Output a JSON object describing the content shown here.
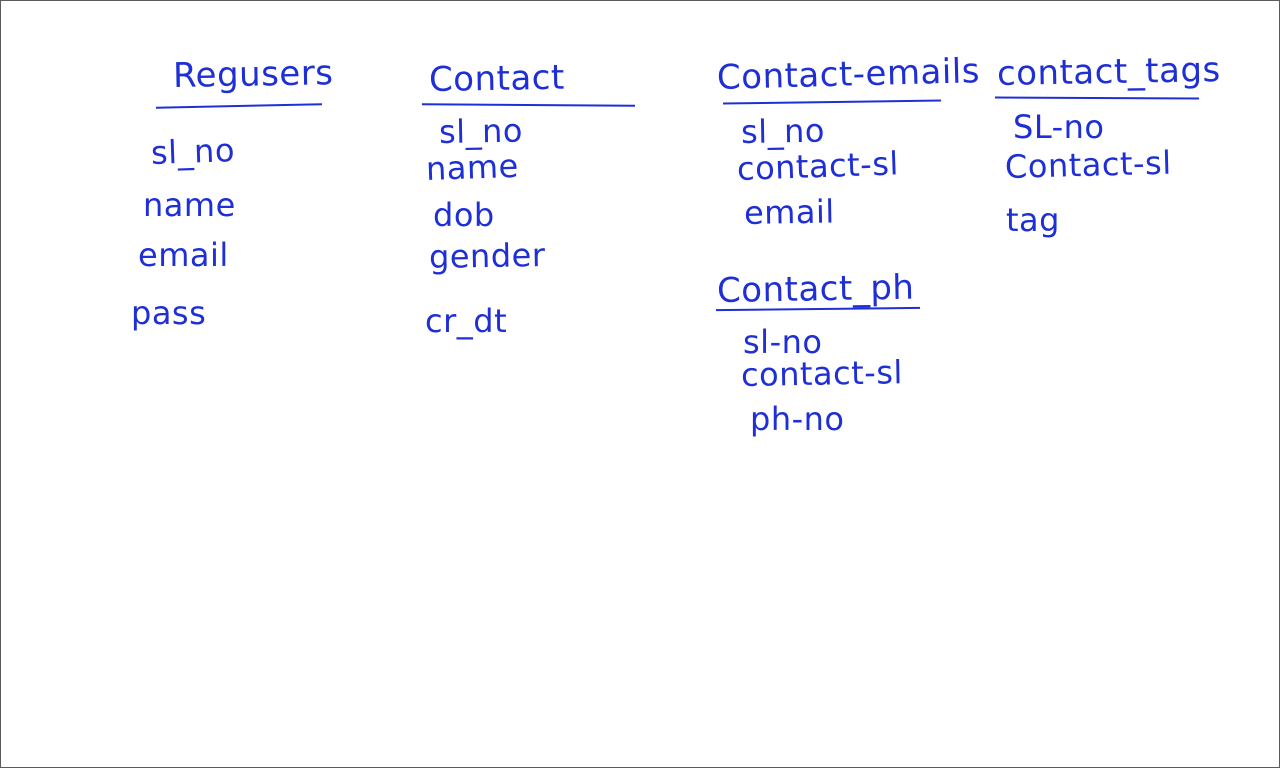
{
  "tables": [
    {
      "title": "Regusers",
      "fields": [
        "sl_no",
        "name",
        "email",
        "pass"
      ]
    },
    {
      "title": "Contact",
      "fields": [
        "sl_no",
        "name",
        "dob",
        "gender",
        "cr_dt"
      ]
    },
    {
      "title": "Contact-emails",
      "fields": [
        "sl_no",
        "contact-sl",
        "email"
      ]
    },
    {
      "title": "Contact_ph",
      "fields": [
        "sl-no",
        "contact-sl",
        "ph-no"
      ]
    },
    {
      "title": "contact_tags",
      "fields": [
        "SL-no",
        "Contact-sl",
        "tag"
      ]
    }
  ],
  "colors": {
    "ink": "#1f2fd6",
    "background": "#ffffff",
    "frame": "#5a5a5a"
  }
}
